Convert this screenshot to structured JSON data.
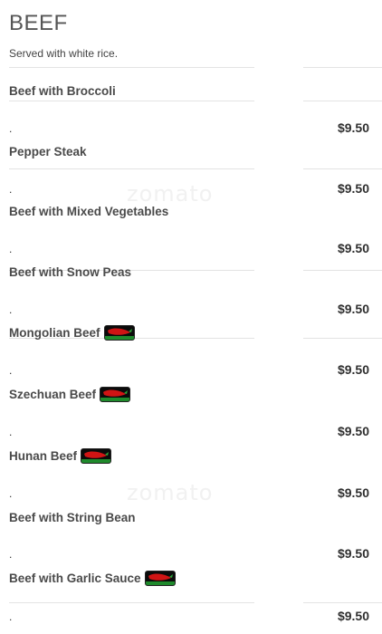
{
  "section": {
    "title": "BEEF",
    "note": "Served with white rice."
  },
  "items": [
    {
      "name": "Beef with Broccoli",
      "dot": ".",
      "price": "$9.50",
      "spicy": false
    },
    {
      "name": "Pepper Steak",
      "dot": ".",
      "price": "$9.50",
      "spicy": false
    },
    {
      "name": "Beef with Mixed Vegetables",
      "dot": ".",
      "price": "$9.50",
      "spicy": false
    },
    {
      "name": "Beef with Snow Peas",
      "dot": ".",
      "price": "$9.50",
      "spicy": false
    },
    {
      "name": "Mongolian Beef",
      "dot": ".",
      "price": "$9.50",
      "spicy": true
    },
    {
      "name": "Szechuan Beef",
      "dot": ".",
      "price": "$9.50",
      "spicy": true
    },
    {
      "name": "Hunan Beef",
      "dot": ".",
      "price": "$9.50",
      "spicy": true
    },
    {
      "name": "Beef with String Bean",
      "dot": ".",
      "price": "$9.50",
      "spicy": false
    },
    {
      "name": "Beef with Garlic Sauce",
      "dot": ".",
      "price": "$9.50",
      "spicy": true
    }
  ],
  "icons": {
    "spicy": "chili-pepper-icon"
  },
  "watermark": "zomato"
}
